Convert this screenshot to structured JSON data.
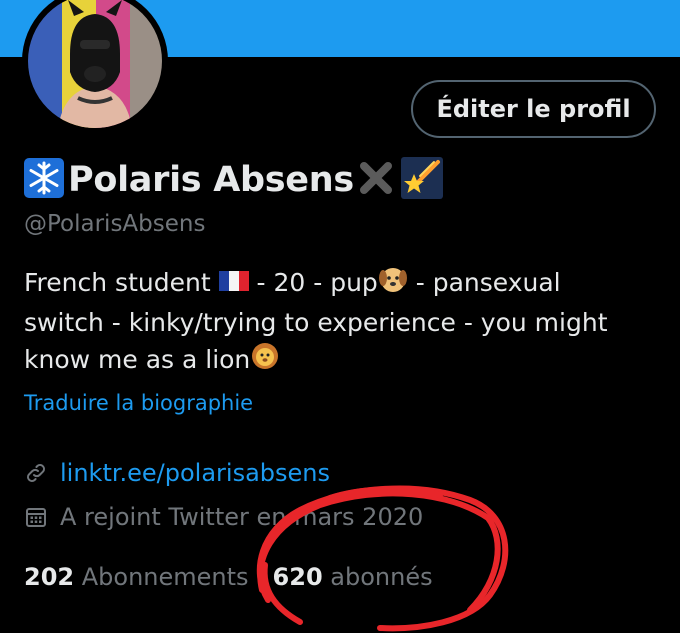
{
  "profile": {
    "edit_label": "Éditer le profil",
    "display_name": "Polaris Absens",
    "handle": "@PolarisAbsens",
    "bio": {
      "line1_a": "French student",
      "line1_b": " - 20 - pup",
      "line1_c": " - pansexual",
      "line2": "switch - kinky/trying to experience - you might",
      "line3": "know me as a lion"
    },
    "translate_label": "Traduire la biographie",
    "link": "linktr.ee/polarisabsens",
    "joined": "A rejoint Twitter en mars 2020",
    "following_count": "202",
    "following_label": "Abonnements",
    "followers_count": "620",
    "followers_label": "abonnés"
  },
  "colors": {
    "banner": "#1d9bf0",
    "link": "#1d9bf0",
    "muted": "#71767b",
    "text": "#e7e9ea",
    "annotation": "#e8262a"
  },
  "icons": [
    "snowflake-icon",
    "cross-mark-icon",
    "shooting-star-icon",
    "france-flag-icon",
    "dog-face-icon",
    "lion-face-icon",
    "link-icon",
    "calendar-icon"
  ]
}
